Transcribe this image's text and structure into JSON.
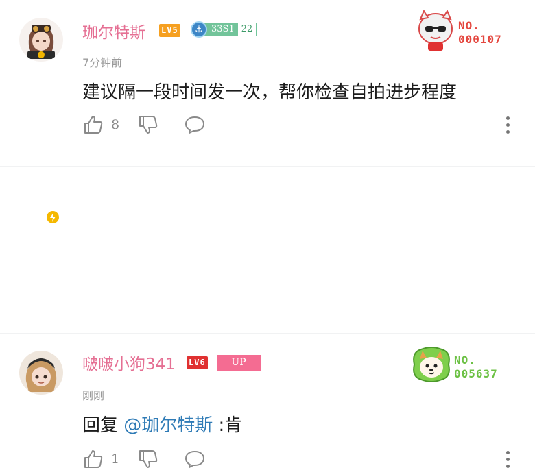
{
  "comments": [
    {
      "username": "珈尔特斯",
      "level": "LV5",
      "medal_name": "33S1",
      "medal_level": "22",
      "time": "7分钟前",
      "content": "建议隔一段时间发一次，帮你检查自拍进步程度",
      "likes": "8",
      "fan_no_label": "NO.",
      "fan_no_number": "000107"
    },
    {
      "username": "啵啵小狗341",
      "level": "LV6",
      "up_badge": "UP",
      "time": "刚刚",
      "reply_prefix": "回复 ",
      "mention": "@珈尔特斯",
      "reply_text": " :肯",
      "likes": "1",
      "fan_no_label": "NO.",
      "fan_no_number": "005637"
    }
  ],
  "colors": {
    "username": "#e56f93",
    "lv5": "#f6a021",
    "lv6": "#e03131",
    "mention": "#2f7bb6",
    "up_badge": "#f46c92",
    "fan_red": "#e4473f",
    "fan_green": "#6cc144"
  }
}
